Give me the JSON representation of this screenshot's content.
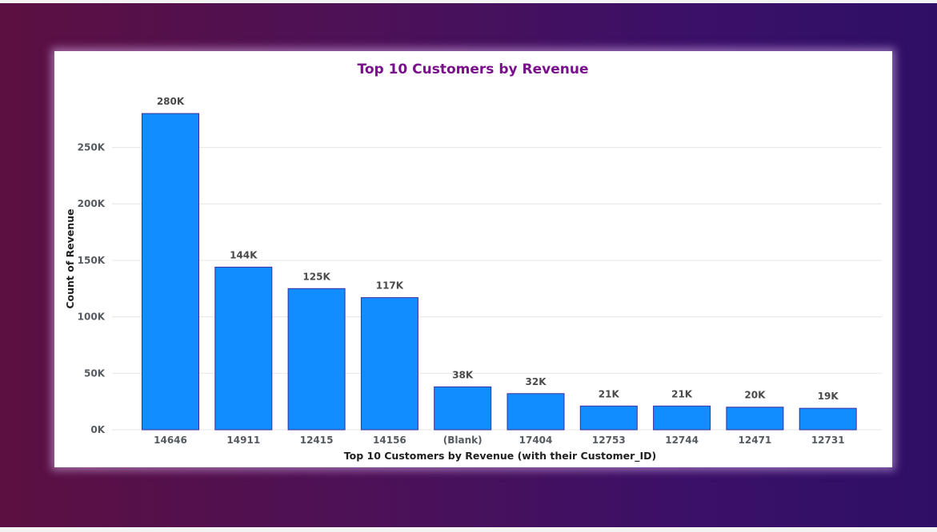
{
  "chart_data": {
    "type": "bar",
    "title": "Top 10 Customers by Revenue",
    "xlabel": "Top 10 Customers by Revenue (with their Customer_ID)",
    "ylabel": "Count of Revenue",
    "categories": [
      "14646",
      "14911",
      "12415",
      "14156",
      "(Blank)",
      "17404",
      "12753",
      "12744",
      "12471",
      "12731"
    ],
    "values": [
      280000,
      144000,
      125000,
      117000,
      38000,
      32000,
      21000,
      21000,
      20000,
      19000
    ],
    "data_labels": [
      "280K",
      "144K",
      "125K",
      "117K",
      "38K",
      "32K",
      "21K",
      "21K",
      "20K",
      "19K"
    ],
    "y_ticks": [
      0,
      50000,
      100000,
      150000,
      200000,
      250000
    ],
    "y_tick_labels": [
      "0K",
      "50K",
      "100K",
      "150K",
      "200K",
      "250K"
    ],
    "ylim": [
      0,
      290000
    ],
    "grid": true,
    "colors": {
      "bar": "#118dff",
      "bar_border": "#3a2ea0",
      "title": "#7a0f8c"
    }
  }
}
